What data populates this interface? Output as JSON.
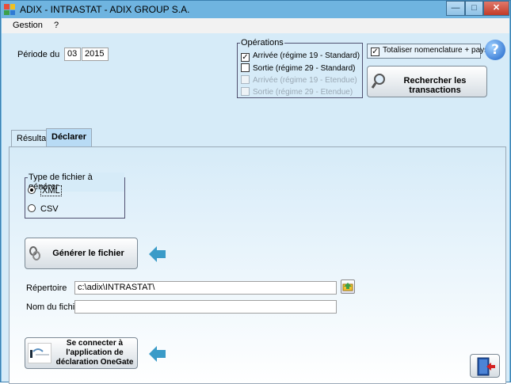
{
  "window": {
    "title": "ADIX - INTRASTAT - ADIX GROUP S.A."
  },
  "titlebar_buttons": {
    "minimize": "—",
    "maximize": "□",
    "close": "✕"
  },
  "menu": {
    "items": [
      "Gestion",
      "?"
    ]
  },
  "period": {
    "label": "Période du",
    "month": "03",
    "year": "2015"
  },
  "operations": {
    "title": "Opérations",
    "options": [
      {
        "label": "Arrivée (régime 19 - Standard)",
        "checked": true,
        "enabled": true
      },
      {
        "label": "Sortie (régime 29 - Standard)",
        "checked": false,
        "enabled": true
      },
      {
        "label": "Arrivée (régime 19 - Etendue)",
        "checked": false,
        "enabled": false
      },
      {
        "label": "Sortie (régime 29 - Etendue)",
        "checked": false,
        "enabled": false
      }
    ]
  },
  "totaliser": {
    "label": "Totaliser nomenclature + pays",
    "checked": true
  },
  "search_button": {
    "label": "Rechercher les transactions"
  },
  "tabs": [
    {
      "label": "Résultat",
      "active": false
    },
    {
      "label": "Déclarer",
      "active": true
    }
  ],
  "file_type": {
    "title": "Type de fichier à générer",
    "options": [
      {
        "label": "XML",
        "selected": true
      },
      {
        "label": "CSV",
        "selected": false
      }
    ]
  },
  "generate_button": {
    "label": "Générer le fichier"
  },
  "directory": {
    "label": "Répertoire",
    "value": "c:\\adix\\INTRASTAT\\"
  },
  "filename": {
    "label": "Nom du fichier",
    "value": ""
  },
  "onegate_button": {
    "label": "Se connecter à l'application de déclaration OneGate"
  },
  "colors": {
    "client_bg": "#d6ebf8",
    "titlebar": "#6fb4e0",
    "arrow": "#3a9bc8",
    "help": "#1c63c8"
  }
}
